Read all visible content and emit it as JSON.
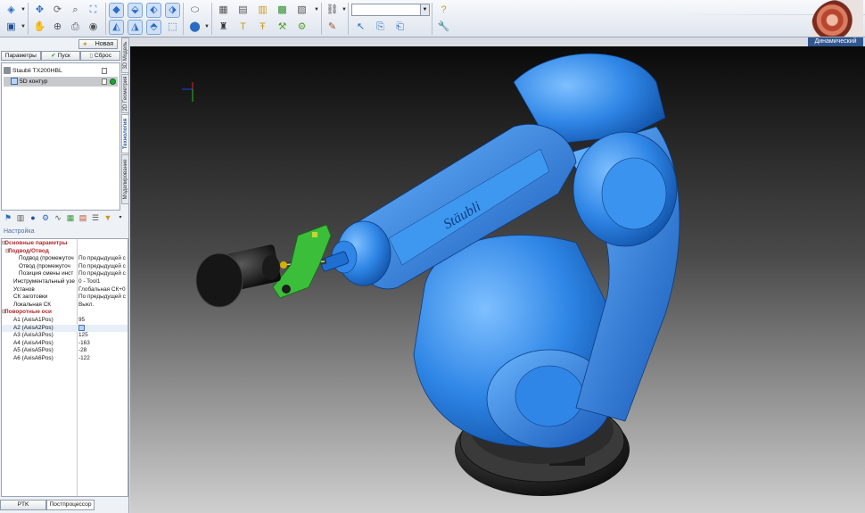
{
  "toolbar": {
    "icons": [
      "layers-icon",
      "save-icon",
      "move-icon",
      "rotate-view-icon",
      "zoom-icon",
      "fit-icon",
      "pan-icon",
      "zoom-window-icon",
      "print-icon",
      "view-front-icon",
      "view-top-icon",
      "view-iso-icon",
      "view-box-icon",
      "cylinder-icon",
      "shaded-view-icon",
      "cube-icon",
      "workpiece-icon",
      "tool-icon",
      "fixture-icon",
      "toolpath-icon",
      "machine-icon",
      "link-icon",
      "measure-icon",
      "export-icon",
      "help-icon"
    ],
    "combo_value": ""
  },
  "logo": "sprutcam-logo",
  "mode_label": "Динамический",
  "left_panel": {
    "new_button": "Новая",
    "tabs": [
      "Параметры",
      "Пуск",
      "Сброс"
    ],
    "vertical_tabs": [
      "3D Модель",
      "2D Геометрия",
      "Технология",
      "Моделирование"
    ],
    "tree": [
      {
        "label": "Staubli TX200HBL",
        "selected": false
      },
      {
        "label": "5D контур",
        "selected": true
      }
    ],
    "section_label": "Настройка",
    "properties": [
      {
        "key": "Основные параметры",
        "value": "",
        "kind": "sec"
      },
      {
        "key": "Подвод/Отвод",
        "value": "",
        "kind": "sub"
      },
      {
        "key": "Подвод (промежуточ",
        "value": "По предыдущей с",
        "kind": "item"
      },
      {
        "key": "Отвод (промежуточ",
        "value": "По предыдущей с",
        "kind": "item"
      },
      {
        "key": "Позиция смены инст",
        "value": "По предыдущей с",
        "kind": "item"
      },
      {
        "key": "Инструментальный узе",
        "value": "0 - Tool1",
        "kind": "item2"
      },
      {
        "key": "Установ",
        "value": "Глобальная СК+0",
        "kind": "item2"
      },
      {
        "key": "СК заготовки",
        "value": "По предыдущей с",
        "kind": "item2"
      },
      {
        "key": "Локальная СК",
        "value": "Выкл.",
        "kind": "item2"
      },
      {
        "key": "Поворотные оси",
        "value": "",
        "kind": "sec"
      },
      {
        "key": "A1 (AxisA1Pos)",
        "value": "95",
        "kind": "axis"
      },
      {
        "key": "A2 (AxisA2Pos)",
        "value": "",
        "kind": "axis-hl"
      },
      {
        "key": "A3 (AxisA3Pos)",
        "value": "125",
        "kind": "axis"
      },
      {
        "key": "A4 (AxisA4Pos)",
        "value": "-163",
        "kind": "axis"
      },
      {
        "key": "A5 (AxisA5Pos)",
        "value": "-28",
        "kind": "axis"
      },
      {
        "key": "A6 (AxisA6Pos)",
        "value": "-122",
        "kind": "axis"
      }
    ],
    "bottom_tabs": [
      "PTK",
      "Постпроцессор"
    ]
  },
  "viewport": {
    "robot_brand": "Stäubli",
    "robot_color": "#2f86e6",
    "part_color": "#3bbf3b",
    "base_color": "#2a2a2a"
  }
}
